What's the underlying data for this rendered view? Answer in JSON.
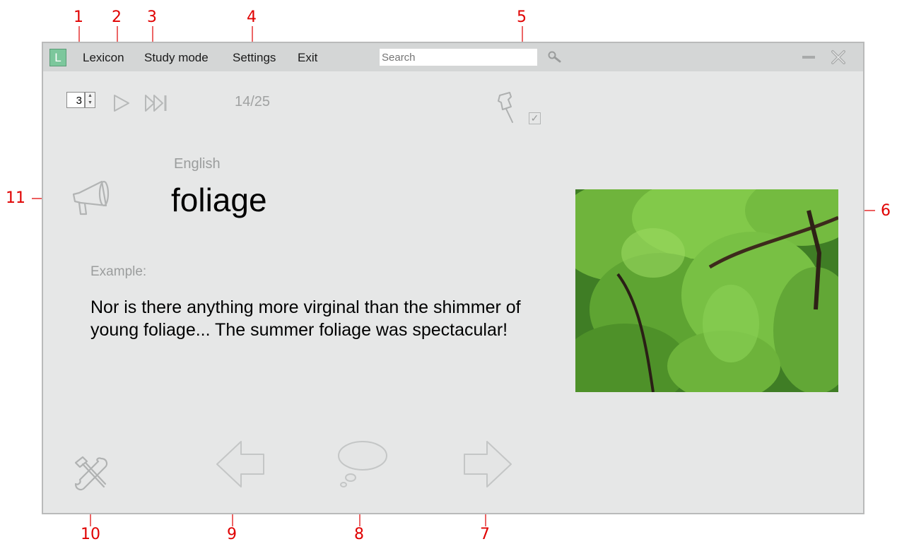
{
  "menu": {
    "logo_letter": "L",
    "items": [
      "Lexicon",
      "Study mode",
      "Settings",
      "Exit"
    ]
  },
  "search": {
    "placeholder": "Search"
  },
  "toolbar": {
    "repeat_count": "3",
    "progress_text": "14/25",
    "learned_checked": true
  },
  "card": {
    "language": "English",
    "word": "foliage",
    "example_label": "Example:",
    "example_text": "Nor is there anything more virginal than the shimmer of young foliage... The summer foliage was spectacular!"
  },
  "icons": {
    "app_logo": "logo-icon",
    "search": "search-icon",
    "minimize": "minimize-icon",
    "close": "close-icon",
    "play": "play-icon",
    "skip": "skip-forward-icon",
    "pin": "pushpin-icon",
    "speaker": "megaphone-icon",
    "settings": "tools-icon",
    "previous": "arrow-left-icon",
    "hint": "thought-bubble-icon",
    "next": "arrow-right-icon"
  },
  "callouts": [
    "1",
    "2",
    "3",
    "4",
    "5",
    "6",
    "7",
    "8",
    "9",
    "10",
    "11"
  ],
  "colors": {
    "window_bg": "#e6e7e7",
    "menubar_bg": "#d4d6d6",
    "logo_green": "#7cc79c",
    "callout_red": "#e00000"
  }
}
